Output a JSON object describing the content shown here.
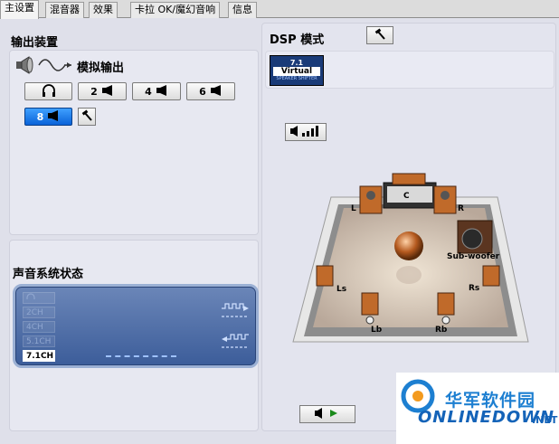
{
  "tabs": [
    {
      "label": "主设置",
      "active": true
    },
    {
      "label": "混音器",
      "active": false
    },
    {
      "label": "效果",
      "active": false
    },
    {
      "label": "卡拉 OK/魔幻音响",
      "active": false
    },
    {
      "label": "信息",
      "active": false
    }
  ],
  "output": {
    "heading": "输出装置",
    "mode_label": "模拟输出",
    "buttons": [
      {
        "label": "",
        "icon": "headphone-icon",
        "selected": false
      },
      {
        "label": "2",
        "icon": "speaker-icon",
        "selected": false
      },
      {
        "label": "4",
        "icon": "speaker-icon",
        "selected": false
      },
      {
        "label": "6",
        "icon": "speaker-icon",
        "selected": false
      },
      {
        "label": "8",
        "icon": "speaker-icon",
        "selected": true
      }
    ]
  },
  "system_status": {
    "heading": "声音系统状态",
    "channels": [
      "2CH",
      "4CH",
      "5.1CH",
      "7.1CH"
    ],
    "active_channel": "7.1CH"
  },
  "dsp": {
    "heading": "DSP 模式",
    "badge_top": "7.1",
    "badge_main": "Virtual",
    "badge_bottom": "SPEAKER SHIFTER"
  },
  "room": {
    "labels": {
      "left": "L",
      "center": "C",
      "right": "R",
      "sub": "Sub-woofer",
      "left_surround": "Ls",
      "right_surround": "Rs",
      "left_back": "Lb",
      "right_back": "Rb"
    }
  },
  "watermark": {
    "cn": "华军软件园",
    "en": "ONLINEDOWN",
    "tld": ".NET"
  },
  "colors": {
    "accent": "#0a62d8",
    "panel": "#e7e8f1",
    "status_screen": "#3c5d9a"
  }
}
